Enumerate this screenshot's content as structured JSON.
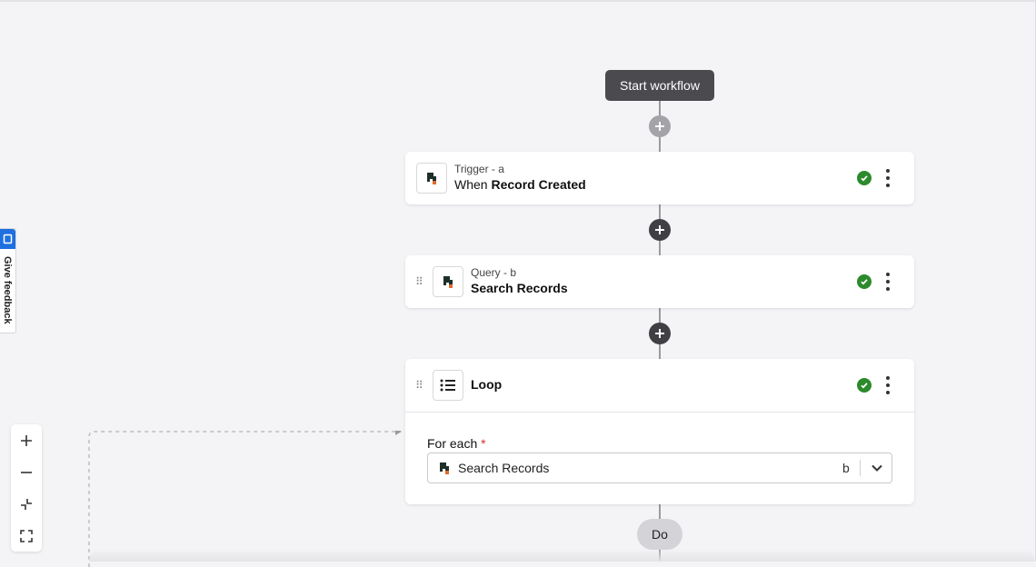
{
  "workflow": {
    "start_label": "Start workflow",
    "do_label": "Do"
  },
  "steps": [
    {
      "subtitle": "Trigger - a",
      "title_prefix": "When ",
      "title_bold": "Record Created",
      "status": "valid",
      "icon": "app-logo-icon"
    },
    {
      "subtitle": "Query - b",
      "title_prefix": "",
      "title_bold": "Search Records",
      "status": "valid",
      "icon": "app-logo-icon"
    },
    {
      "subtitle": "",
      "title_prefix": "",
      "title_bold": "Loop",
      "status": "valid",
      "icon": "list-icon"
    }
  ],
  "loop": {
    "for_each_label": "For each",
    "required_marker": "*",
    "selected_value": "Search Records",
    "selected_badge": "b"
  },
  "feedback": {
    "label": "Give feedback"
  },
  "zoom_controls": [
    "zoom-in-icon",
    "zoom-out-icon",
    "fit-view-icon",
    "fullscreen-icon"
  ],
  "colors": {
    "success": "#2c8a2c",
    "feedback_accent": "#1f6fe0",
    "start_button": "#4a4a4f"
  }
}
